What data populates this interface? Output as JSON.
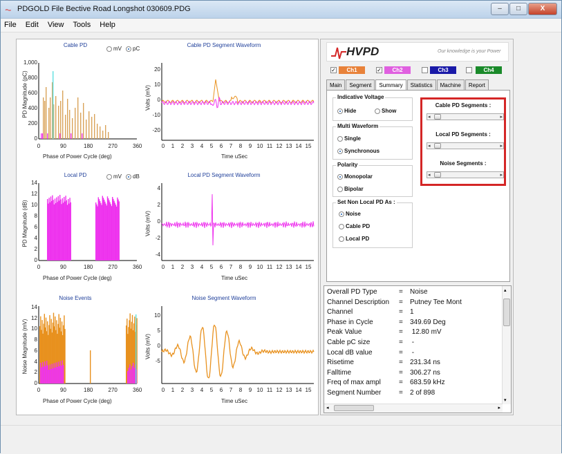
{
  "window": {
    "title": "PDGOLD File    Bective Road  Longshot 030609.PDG",
    "controls": [
      "–",
      "□",
      "X"
    ]
  },
  "menu": [
    "File",
    "Edit",
    "View",
    "Tools",
    "Help"
  ],
  "plots": {
    "cable_pd": {
      "title": "Cable PD",
      "radio_a": "mV",
      "radio_b": "pC",
      "selected": "pC",
      "ylabel": "PD Magnitude (pC)",
      "xlabel": "Phase of Power Cycle (deg)",
      "yticks": [
        "1,000",
        "800",
        "600",
        "400",
        "200",
        "0"
      ],
      "xticks": [
        "0",
        "90",
        "180",
        "270",
        "360"
      ]
    },
    "cable_wave": {
      "title": "Cable PD Segment Waveform",
      "ylabel": "Volts (mV)",
      "xlabel": "Time  uSec",
      "yticks": [
        "20",
        "10",
        "0",
        "-10",
        "-20"
      ],
      "xticks": [
        "0",
        "1",
        "2",
        "3",
        "4",
        "5",
        "6",
        "7",
        "8",
        "9",
        "10",
        "11",
        "12",
        "13",
        "14",
        "15"
      ]
    },
    "local_pd": {
      "title": "Local PD",
      "radio_a": "mV",
      "radio_b": "dB",
      "selected": "dB",
      "ylabel": "PD Magnitude (dB)",
      "xlabel": "Phase of Power Cycle (deg)",
      "yticks": [
        "14",
        "12",
        "10",
        "8",
        "6",
        "4",
        "2",
        "0"
      ],
      "xticks": [
        "0",
        "90",
        "180",
        "270",
        "360"
      ]
    },
    "local_wave": {
      "title": "Local PD Segment Waveform",
      "ylabel": "Volts (mV)",
      "xlabel": "Time  uSec",
      "yticks": [
        "4",
        "2",
        "0",
        "-2",
        "-4"
      ],
      "xticks": [
        "0",
        "1",
        "2",
        "3",
        "4",
        "5",
        "6",
        "7",
        "8",
        "9",
        "10",
        "11",
        "12",
        "13",
        "14",
        "15"
      ]
    },
    "noise": {
      "title": "Noise Events",
      "ylabel": "Noise Magnitude (mV)",
      "xlabel": "Phase of Power Cycle (deg)",
      "yticks": [
        "14",
        "12",
        "10",
        "8",
        "6",
        "4",
        "2",
        "0"
      ],
      "xticks": [
        "0",
        "90",
        "180",
        "270",
        "360"
      ]
    },
    "noise_wave": {
      "title": "Noise Segment Waveform",
      "ylabel": "Volts (mV)",
      "xlabel": "Time  uSec",
      "yticks": [
        "10",
        "5",
        "0",
        "-5"
      ],
      "xticks": [
        "0",
        "1",
        "2",
        "3",
        "4",
        "5",
        "6",
        "7",
        "8",
        "9",
        "10",
        "11",
        "12",
        "13",
        "14",
        "15"
      ]
    }
  },
  "logo": {
    "name": "HVPD",
    "tagline": "Our knowledge is your Power"
  },
  "channels": [
    {
      "label": "Ch1",
      "checked": true,
      "color": "#e8823a"
    },
    {
      "label": "Ch2",
      "checked": true,
      "color": "#e060e0"
    },
    {
      "label": "Ch3",
      "checked": false,
      "color": "#1a1aa8"
    },
    {
      "label": "Ch4",
      "checked": false,
      "color": "#1a8a2a"
    }
  ],
  "tabs": [
    "Main",
    "Segment",
    "Summary",
    "Statistics",
    "Machine",
    "Report"
  ],
  "active_tab": "Summary",
  "groups": {
    "indicative": {
      "title": "Indicative Voltage",
      "opt1": "Hide",
      "opt2": "Show"
    },
    "multi": {
      "title": "Multi Waveform",
      "opt1": "Single",
      "opt2": "Synchronous"
    },
    "polarity": {
      "title": "Polarity",
      "opt1": "Monopolar",
      "opt2": "Bipolar"
    },
    "nonlocal": {
      "title": "Set Non Local PD As :",
      "opt1": "Noise",
      "opt2": "Cable PD",
      "opt3": "Local PD"
    }
  },
  "segments": {
    "cable": "Cable PD Segments :",
    "local": "Local PD Segments :",
    "noise": "Noise Segments :"
  },
  "info": [
    {
      "key": "Overall PD Type",
      "val": "Noise"
    },
    {
      "key": "Channel Description",
      "val": "Putney Tee Mont"
    },
    {
      "key": "Channel",
      "val": "1"
    },
    {
      "key": "Phase in Cycle",
      "val": "349.69 Deg"
    },
    {
      "key": "Peak Value",
      "val": "  12.80 mV"
    },
    {
      "key": "Cable pC size",
      "val": "     -"
    },
    {
      "key": "Local dB value",
      "val": "     -"
    },
    {
      "key": "Risetime",
      "val": "231.34 ns"
    },
    {
      "key": "Falltime",
      "val": "306.27 ns"
    },
    {
      "key": "Freq of max ampl",
      "val": "683.59 kHz"
    },
    {
      "key": "Segment Number",
      "val": "2 of 898"
    }
  ],
  "colors": {
    "orange": "#e8911e",
    "magenta": "#ee33ee",
    "cyan": "#5ee0e0",
    "tan": "#d9a35a",
    "red_highlight": "#d42626"
  }
}
